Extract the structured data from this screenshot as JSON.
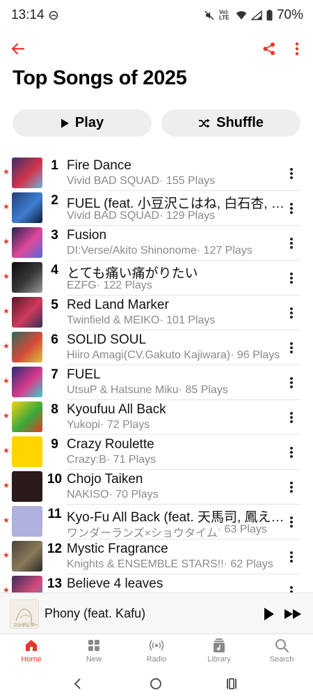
{
  "status_bar": {
    "time": "13:14",
    "network_label": "Vo) LTE",
    "battery_percent": "70%"
  },
  "header": {
    "title": "Top Songs of 2025",
    "back_icon": "arrow-left-icon",
    "share_icon": "share-icon",
    "more_icon": "more-vertical-icon"
  },
  "actions": {
    "play_label": "Play",
    "shuffle_label": "Shuffle"
  },
  "songs": [
    {
      "rank": "1",
      "title": "Fire Dance",
      "artist": "Vivid BAD SQUAD",
      "plays": " · 155 Plays",
      "favorite": true,
      "art_colors": [
        "#3b2f6b",
        "#d2334b",
        "#6fb2d9"
      ]
    },
    {
      "rank": "2",
      "title": "FUEL (feat. 小豆沢こはね, 白石杏, 東雲彰人 & 青柳冬弥)",
      "artist": "Vivid BAD SQUAD",
      "plays": " · 129 Plays",
      "favorite": true,
      "art_colors": [
        "#1f3f7a",
        "#3f7fd0",
        "#0d1b3a"
      ]
    },
    {
      "rank": "3",
      "title": "Fusion",
      "artist": "DI:Verse/Akito Shinonome",
      "plays": " · 127 Plays",
      "favorite": true,
      "art_colors": [
        "#2a2250",
        "#e0489b",
        "#4f6fd9"
      ]
    },
    {
      "rank": "4",
      "title": "とても痛い痛がりたい",
      "artist": "EZFG",
      "plays": " · 122 Plays",
      "favorite": true,
      "art_colors": [
        "#0b0b0b",
        "#3a3a3a",
        "#9a9a9a"
      ]
    },
    {
      "rank": "5",
      "title": "Red Land Marker",
      "artist": "Twinfield & MEIKO",
      "plays": " · 101 Plays",
      "favorite": true,
      "art_colors": [
        "#5a1a2a",
        "#d03a5a",
        "#2d2d5a"
      ]
    },
    {
      "rank": "6",
      "title": "SOLID SOUL",
      "artist": "Hiiro Amagi(CV.Gakuto Kajiwara)",
      "plays": " · 96 Plays",
      "favorite": true,
      "art_colors": [
        "#2c6b5e",
        "#d84a3a",
        "#d9c23a"
      ]
    },
    {
      "rank": "7",
      "title": "FUEL",
      "artist": "UtsuP & Hatsune Miku",
      "plays": " · 85 Plays",
      "favorite": true,
      "art_colors": [
        "#2a2a7a",
        "#d83a8a",
        "#3ad0d0"
      ]
    },
    {
      "rank": "8",
      "title": "Kyoufuu All Back",
      "artist": "Yukopi",
      "plays": " · 72 Plays",
      "favorite": true,
      "art_colors": [
        "#f2d218",
        "#3aa83a",
        "#e23a2a"
      ]
    },
    {
      "rank": "9",
      "title": "Crazy Roulette",
      "artist": "Crazy:B",
      "plays": " · 71 Plays",
      "favorite": true,
      "art_colors": [
        "#ffd400",
        "#ffd400",
        "#ffd400"
      ]
    },
    {
      "rank": "10",
      "title": "Chojo Taiken",
      "artist": "NAKISO",
      "plays": " · 70 Plays",
      "favorite": true,
      "art_colors": [
        "#2a1a1a",
        "#2a1a1a",
        "#2a1a1a"
      ]
    },
    {
      "rank": "11",
      "title": "Kyo-Fu All Back (feat. 天馬司, 鳳えむ & 神代類)",
      "artist": "ワンダーランズ×ショウタイム",
      "plays": " · 63 Plays",
      "favorite": true,
      "art_colors": [
        "#b0b0dc",
        "#b0b0dc",
        "#b0b0dc"
      ]
    },
    {
      "rank": "12",
      "title": "Mystic Fragrance",
      "artist": "Knights & ENSEMBLE STARS!!",
      "plays": " · 62 Plays",
      "favorite": true,
      "art_colors": [
        "#4a4438",
        "#8a7a5a",
        "#2a2a2a"
      ]
    },
    {
      "rank": "13",
      "title": "Believe 4 leaves",
      "artist": "",
      "plays": "",
      "favorite": true,
      "art_colors": [
        "#3a2a5a",
        "#d04a7a",
        "#5a8ad0"
      ]
    }
  ],
  "mini_player": {
    "title": "Phony (feat. Kafu)",
    "art_text": "シンデレラーー",
    "play_icon": "play-icon",
    "next_icon": "skip-forward-icon"
  },
  "tabs": [
    {
      "label": "Home",
      "icon": "home-icon",
      "active": true
    },
    {
      "label": "New",
      "icon": "grid-icon",
      "active": false
    },
    {
      "label": "Radio",
      "icon": "radio-icon",
      "active": false
    },
    {
      "label": "Library",
      "icon": "library-icon",
      "active": false
    },
    {
      "label": "Search",
      "icon": "search-icon",
      "active": false
    }
  ],
  "colors": {
    "accent": "#e8352b",
    "secondary_text": "#8a8a8e",
    "button_bg": "#eeeeef"
  }
}
